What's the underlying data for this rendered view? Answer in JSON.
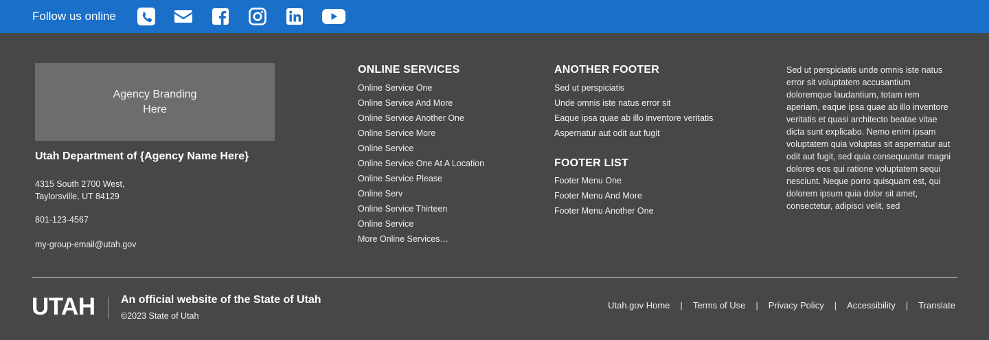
{
  "follow": {
    "label": "Follow us online",
    "icons": [
      "phone-icon",
      "email-icon",
      "facebook-icon",
      "instagram-icon",
      "linkedin-icon",
      "youtube-icon"
    ]
  },
  "agency": {
    "branding_placeholder": "Agency Branding Here",
    "name": "Utah Department of {Agency Name Here}",
    "address_line1": "4315 South 2700 West,",
    "address_line2": "Taylorsville, UT 84129",
    "phone": "801-123-4567",
    "email": "my-group-email@utah.gov"
  },
  "online_services": {
    "title": "ONLINE SERVICES",
    "items": [
      "Online Service One",
      "Online Service And More",
      "Online Service Another One",
      "Online Service More",
      "Online Service",
      "Online Service One At A Location",
      "Online Service Please",
      "Online Serv",
      "Online Service Thirteen",
      "Online Service",
      "More Online Services…"
    ]
  },
  "another_footer": {
    "title": "ANOTHER FOOTER",
    "items": [
      "Sed ut perspiciatis",
      "Unde omnis iste natus error sit",
      "Eaque ipsa quae ab illo inventore veritatis",
      "Aspernatur aut odit aut fugit"
    ]
  },
  "footer_list": {
    "title": "FOOTER LIST",
    "items": [
      "Footer Menu One",
      "Footer Menu And More",
      "Footer Menu Another One"
    ]
  },
  "lorem_text": "Sed ut perspiciatis unde omnis iste natus error sit voluptatem accusantium doloremque laudantium, totam rem aperiam, eaque ipsa quae ab illo inventore veritatis et quasi architecto beatae vitae dicta sunt explicabo. Nemo enim ipsam voluptatem quia voluptas sit aspernatur aut odit aut fugit, sed quia consequuntur magni dolores eos qui ratione voluptatem sequi nesciunt. Neque porro quisquam est, qui dolorem ipsum quia dolor sit amet, consectetur, adipisci velit, sed",
  "bottom": {
    "logo": "UTAH",
    "official_text": "An official website of the State of Utah",
    "copyright": "©2023 State of Utah",
    "links": [
      "Utah.gov Home",
      "Terms of Use",
      "Privacy Policy",
      "Accessibility",
      "Translate"
    ],
    "separator": "|"
  },
  "colors": {
    "top_bar": "#1a70c9",
    "footer_bg": "#474747",
    "branding_box": "#6d6d6d"
  }
}
